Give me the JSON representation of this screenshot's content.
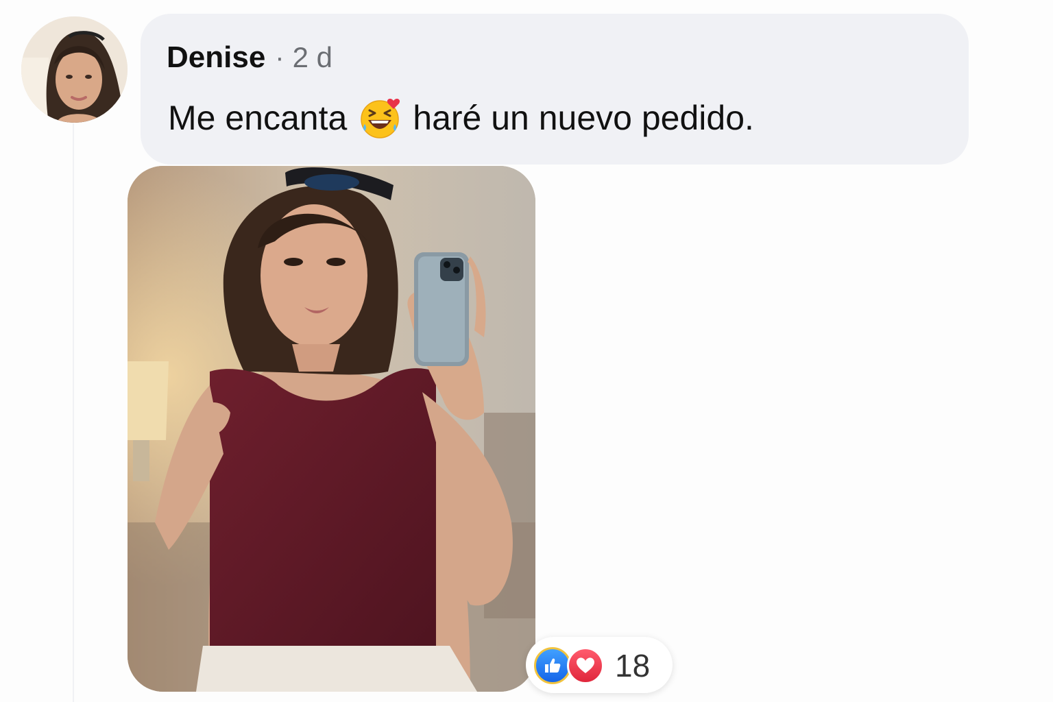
{
  "comment": {
    "author": "Denise",
    "separator": "·",
    "timestamp": "2 d",
    "text_before_emoji": "Me encanta",
    "emoji": "laughing-face-with-heart-emoji",
    "text_after_emoji": "haré un nuevo pedido."
  },
  "reactions": {
    "icons": [
      "like-icon",
      "love-icon"
    ],
    "count": "18"
  },
  "colors": {
    "bubble": "#f0f1f5",
    "like_blue": "#1877f2",
    "love_red": "#f33e58",
    "text": "#111111",
    "muted": "#6b6e73"
  }
}
